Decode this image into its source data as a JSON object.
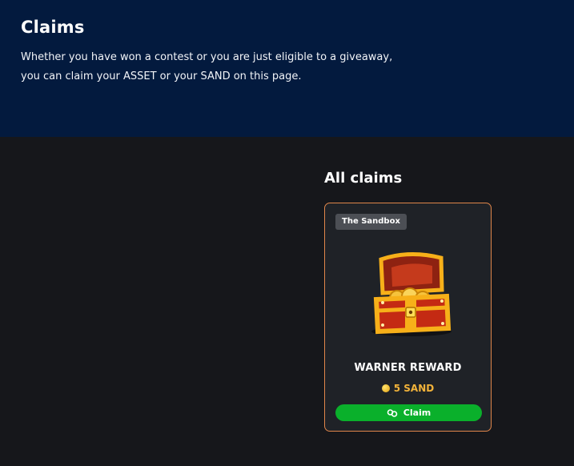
{
  "hero": {
    "title": "Claims",
    "description_line1": "Whether you have won a contest or you are just eligible to a giveaway,",
    "description_line2": "you can claim your ASSET or your SAND on this page."
  },
  "claims": {
    "section_title": "All claims",
    "items": [
      {
        "badge": "The Sandbox",
        "image_icon": "treasure-chest-icon",
        "title": "WARNER REWARD",
        "price": "5 SAND",
        "price_icon": "sand-coin-icon",
        "button_label": "Claim",
        "button_icon": "link-icon"
      }
    ]
  },
  "colors": {
    "hero_bg": "#031a3e",
    "page_bg": "#16171b",
    "card_bg": "#1f2227",
    "card_border": "#e0864a",
    "price": "#f2b33a",
    "claim_button": "#0ab02b"
  }
}
